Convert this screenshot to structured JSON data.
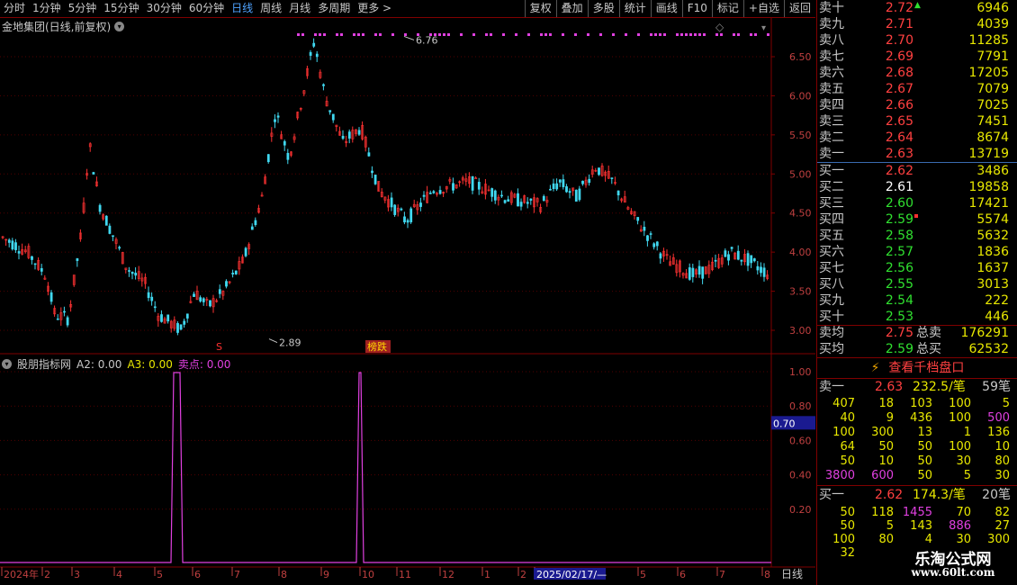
{
  "toolbar": {
    "periods": [
      "分时",
      "1分钟",
      "5分钟",
      "15分钟",
      "30分钟",
      "60分钟",
      "日线",
      "周线",
      "月线",
      "多周期",
      "更多 >"
    ],
    "active": "日线",
    "actions": [
      "复权",
      "叠加",
      "多股",
      "统计",
      "画线",
      "F10",
      "标记",
      "+自选",
      "返回"
    ]
  },
  "chart": {
    "title": "金地集团(日线,前复权)",
    "high_label": "6.76",
    "low_label": "2.89",
    "signal_label": "榜跌",
    "s_marker": "S",
    "y_ticks": [
      "6.50",
      "6.00",
      "5.50",
      "5.00",
      "4.50",
      "4.00",
      "3.50",
      "3.00"
    ],
    "ohlc_hint": "daily candlesticks, price range 2.89 - 6.76"
  },
  "indicator": {
    "name": "股朋指标网",
    "a2": "A2: 0.00",
    "a3": "A3: 0.00",
    "sell": "卖点: 0.00",
    "y_ticks": [
      "1.00",
      "0.80",
      "0.60",
      "0.40",
      "0.20"
    ],
    "cursor_value": "0.70"
  },
  "xaxis": {
    "labels": [
      "2024年",
      "2",
      "3",
      "4",
      "5",
      "6",
      "7",
      "8",
      "9",
      "10",
      "11",
      "12",
      "1",
      "2",
      "2025/02/17/—",
      "5",
      "6",
      "7",
      "8"
    ],
    "period_label": "日线"
  },
  "orderbook": {
    "asks": [
      {
        "label": "卖十",
        "price": "2.72",
        "vol": "6946"
      },
      {
        "label": "卖九",
        "price": "2.71",
        "vol": "4039"
      },
      {
        "label": "卖八",
        "price": "2.70",
        "vol": "11285"
      },
      {
        "label": "卖七",
        "price": "2.69",
        "vol": "7791"
      },
      {
        "label": "卖六",
        "price": "2.68",
        "vol": "17205"
      },
      {
        "label": "卖五",
        "price": "2.67",
        "vol": "7079"
      },
      {
        "label": "卖四",
        "price": "2.66",
        "vol": "7025"
      },
      {
        "label": "卖三",
        "price": "2.65",
        "vol": "7451"
      },
      {
        "label": "卖二",
        "price": "2.64",
        "vol": "8674"
      },
      {
        "label": "卖一",
        "price": "2.63",
        "vol": "13719"
      }
    ],
    "bids": [
      {
        "label": "买一",
        "price": "2.62",
        "vol": "3486",
        "pc": "red"
      },
      {
        "label": "买二",
        "price": "2.61",
        "vol": "19858",
        "pc": "white"
      },
      {
        "label": "买三",
        "price": "2.60",
        "vol": "17421",
        "pc": "green"
      },
      {
        "label": "买四",
        "price": "2.59",
        "vol": "5574",
        "pc": "green"
      },
      {
        "label": "买五",
        "price": "2.58",
        "vol": "5632",
        "pc": "green"
      },
      {
        "label": "买六",
        "price": "2.57",
        "vol": "1836",
        "pc": "green"
      },
      {
        "label": "买七",
        "price": "2.56",
        "vol": "1637",
        "pc": "green"
      },
      {
        "label": "买八",
        "price": "2.55",
        "vol": "3013",
        "pc": "green"
      },
      {
        "label": "买九",
        "price": "2.54",
        "vol": "222",
        "pc": "green"
      },
      {
        "label": "买十",
        "price": "2.53",
        "vol": "446",
        "pc": "green"
      }
    ],
    "ask_avg_label": "卖均",
    "ask_avg": "2.75",
    "ask_total_label": "总卖",
    "ask_total": "176291",
    "bid_avg_label": "买均",
    "bid_avg": "2.59",
    "bid_total_label": "总买",
    "bid_total": "62532",
    "qianda_button": "查看千档盘口",
    "sell1_detail": {
      "label": "卖一",
      "price": "2.63",
      "avg": "232.5/笔",
      "count": "59笔"
    },
    "sell_queue": [
      [
        "407",
        "18",
        "103",
        "100",
        "5"
      ],
      [
        "40",
        "9",
        "436",
        "100",
        "500"
      ],
      [
        "100",
        "300",
        "13",
        "1",
        "136"
      ],
      [
        "64",
        "50",
        "50",
        "100",
        "10"
      ],
      [
        "50",
        "10",
        "50",
        "30",
        "80"
      ],
      [
        "3800",
        "600",
        "50",
        "5",
        "30"
      ]
    ],
    "buy1_detail": {
      "label": "买一",
      "price": "2.62",
      "avg": "174.3/笔",
      "count": "20笔"
    },
    "buy_queue": [
      [
        "50",
        "118",
        "1455",
        "70",
        "82"
      ],
      [
        "50",
        "5",
        "143",
        "886",
        "27"
      ],
      [
        "100",
        "80",
        "4",
        "30",
        "300"
      ],
      [
        "32",
        "",
        "",
        "",
        ""
      ]
    ]
  },
  "watermark": {
    "line1": "乐淘公式网",
    "line2": "www.60lt.com"
  }
}
